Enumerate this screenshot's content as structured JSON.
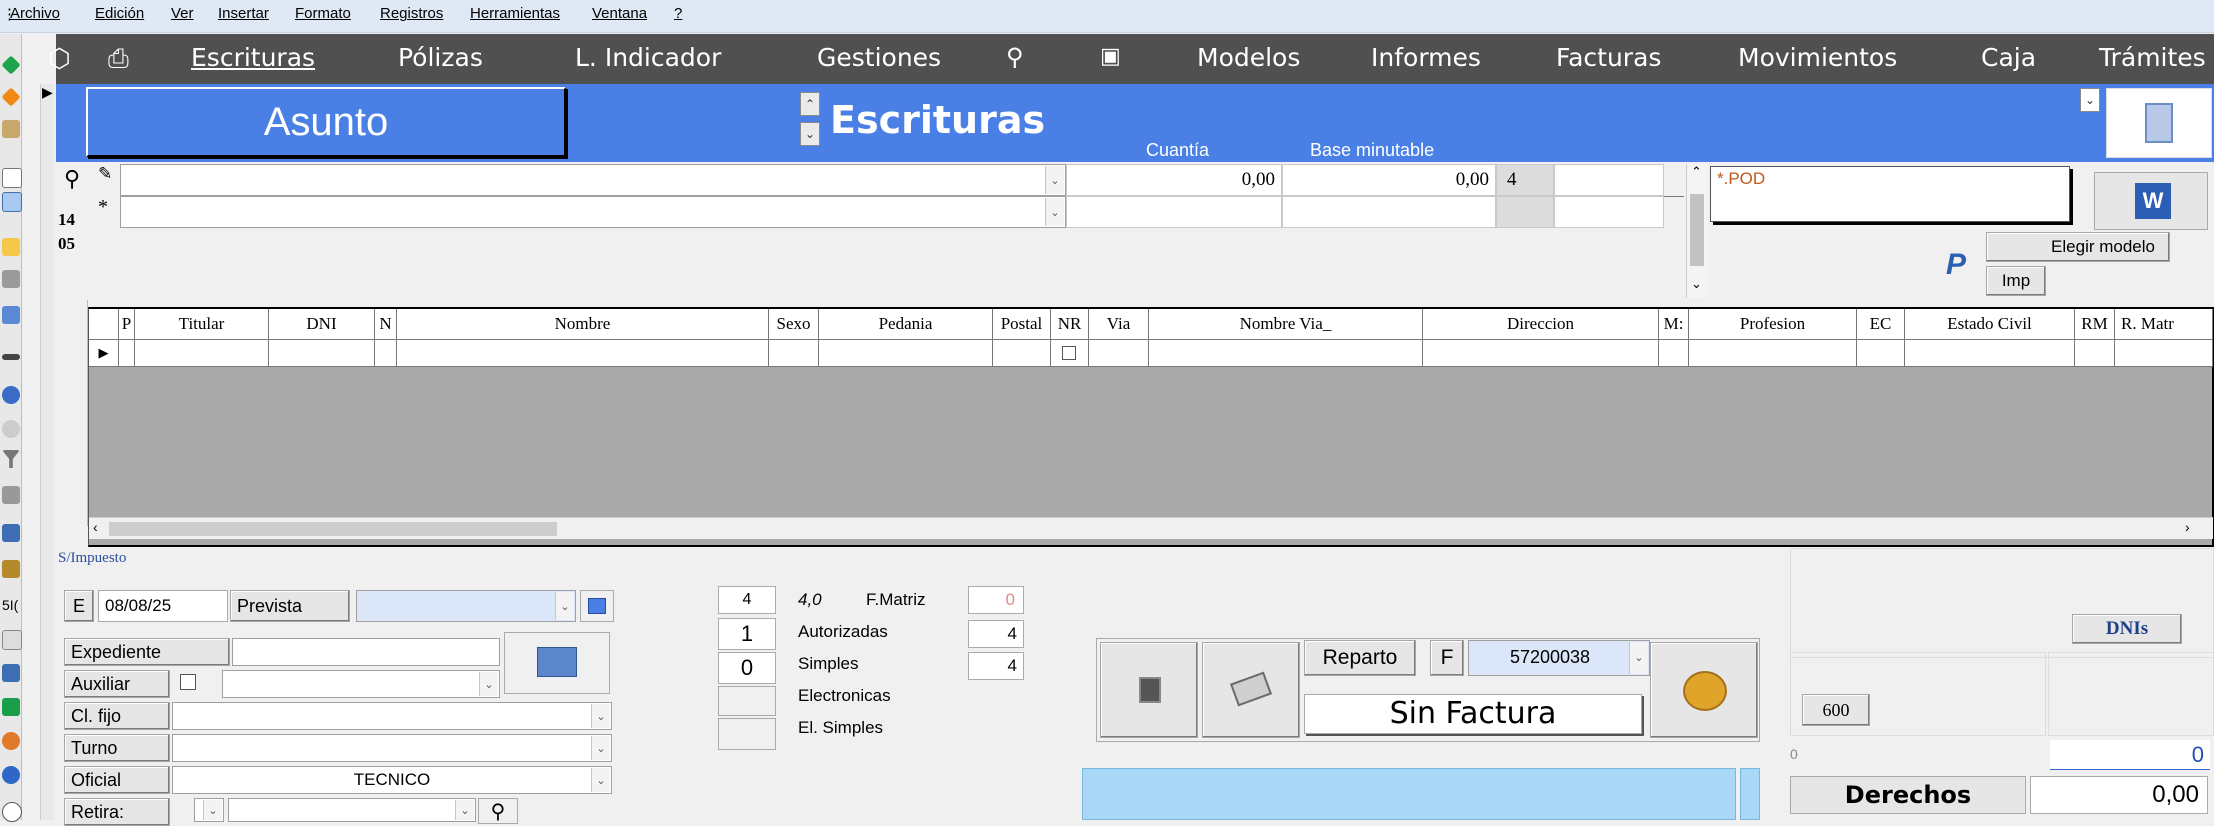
{
  "menu": [
    "Archivo",
    "Edición",
    "Ver",
    "Insertar",
    "Formato",
    "Registros",
    "Herramientas",
    "Ventana",
    "?"
  ],
  "nav": {
    "items": [
      "Escrituras",
      "Pólizas",
      "L. Indicador",
      "Gestiones",
      "Modelos",
      "Informes",
      "Facturas",
      "Movimientos",
      "Caja",
      "Trámites"
    ]
  },
  "header": {
    "asunto": "Asunto",
    "section": "Escrituras",
    "cuantia_label": "Cuantía",
    "base_label": "Base minutable"
  },
  "top_rows": {
    "row_marker_1": "✎",
    "row_marker_2": "*",
    "cuantia": "0,00",
    "base": "0,00",
    "count": "4",
    "file_filter": "*.POD",
    "side_numbers": [
      "14",
      "05"
    ],
    "elegir_modelo": "Elegir modelo",
    "imp": "Imp"
  },
  "grid": {
    "columns": [
      "P",
      "Titular",
      "DNI",
      "N",
      "Nombre",
      "Sexo",
      "Pedania",
      "Postal",
      "NR",
      "Via",
      "Nombre Via_",
      "Direccion",
      "M:",
      "Profesion",
      "EC",
      "Estado Civil",
      "RM",
      "R. Matr"
    ]
  },
  "impuesto_label": "S/Impuesto",
  "form": {
    "e": "E",
    "date": "08/08/25",
    "prevista": "Prevista",
    "expediente": "Expediente",
    "auxiliar": "Auxiliar",
    "cl_fijo": "Cl. fijo",
    "turno": "Turno",
    "oficial": "Oficial",
    "oficial_value": "TECNICO",
    "retira": "Retira:"
  },
  "matriz": {
    "n": "4",
    "ratio": "4,0",
    "label": "F.Matriz",
    "value": "0",
    "rows": [
      {
        "left": "1",
        "label": "Autorizadas",
        "right": "4"
      },
      {
        "left": "0",
        "label": "Simples",
        "right": "4"
      },
      {
        "left": "",
        "label": "Electronicas",
        "right": ""
      },
      {
        "left": "",
        "label": "El. Simples",
        "right": ""
      }
    ]
  },
  "factura": {
    "reparto": "Reparto",
    "f": "F",
    "number": "57200038",
    "status": "Sin Factura"
  },
  "right_panel": {
    "dnis": "DNIs",
    "b600": "600",
    "zero_small": "0",
    "zero_value": "0",
    "derechos": "Derechos",
    "derechos_value": "0,00"
  }
}
